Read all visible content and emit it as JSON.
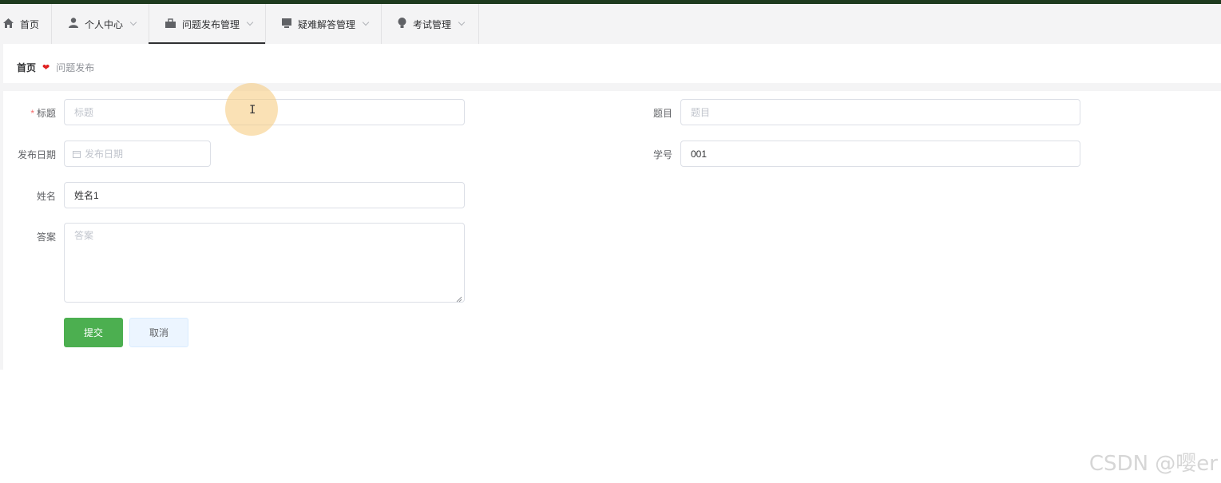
{
  "nav": {
    "items": [
      {
        "label": "首页",
        "icon": "home-icon",
        "has_dropdown": false
      },
      {
        "label": "个人中心",
        "icon": "user-icon",
        "has_dropdown": true
      },
      {
        "label": "问题发布管理",
        "icon": "briefcase-icon",
        "has_dropdown": true,
        "active": true
      },
      {
        "label": "疑难解答管理",
        "icon": "monitor-icon",
        "has_dropdown": true
      },
      {
        "label": "考试管理",
        "icon": "bulb-icon",
        "has_dropdown": true
      }
    ]
  },
  "breadcrumb": {
    "home": "首页",
    "current": "问题发布"
  },
  "form": {
    "title": {
      "label": "标题",
      "required_mark": "*",
      "placeholder": "标题",
      "value": ""
    },
    "question": {
      "label": "题目",
      "placeholder": "题目",
      "value": ""
    },
    "publish_date": {
      "label": "发布日期",
      "placeholder": "发布日期"
    },
    "student_no": {
      "label": "学号",
      "value": "001"
    },
    "name": {
      "label": "姓名",
      "value": "姓名1"
    },
    "answer": {
      "label": "答案",
      "placeholder": "答案"
    },
    "submit_label": "提交",
    "cancel_label": "取消"
  },
  "colors": {
    "accent": "#4caf50",
    "required": "#f56c6c",
    "crumb_separator": "#e02020",
    "top_bar": "#1e3a1e"
  },
  "watermark": "CSDN @嘤er"
}
